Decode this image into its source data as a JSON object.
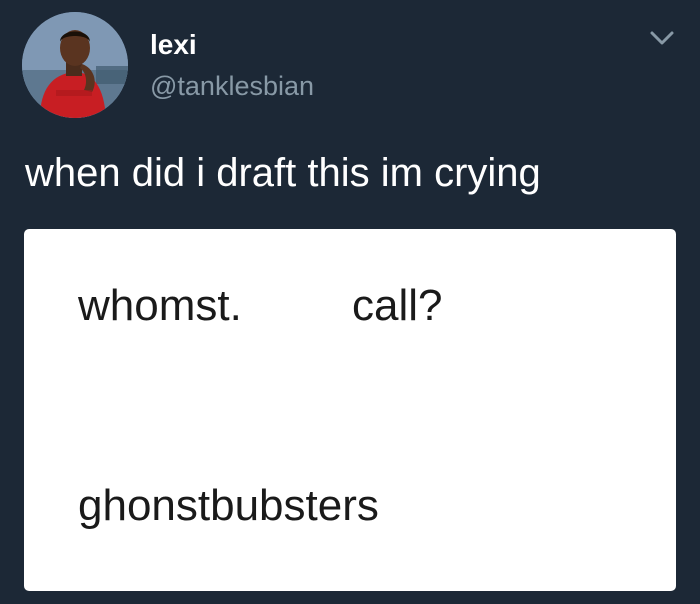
{
  "tweet": {
    "display_name": "lexi",
    "handle": "@tanklesbian",
    "text": "when did i draft this im crying",
    "avatar_icon": "profile-photo",
    "menu_icon": "chevron-down-icon"
  },
  "draft": {
    "line1_a": "whomst.",
    "line1_b": "call?",
    "line2": "ghonstbubsters"
  },
  "colors": {
    "background": "#1c2836",
    "name": "#ffffff",
    "handle": "#8899a6",
    "card": "#ffffff",
    "card_text": "#1a1a1a"
  }
}
